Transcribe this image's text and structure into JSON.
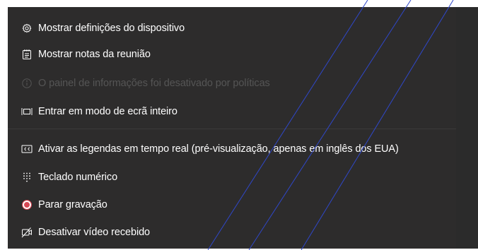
{
  "menu": {
    "items": [
      {
        "label": "Mostrar definições do dispositivo",
        "icon": "gear-icon",
        "enabled": true
      },
      {
        "label": "Mostrar notas da reunião",
        "icon": "notes-icon",
        "enabled": true
      },
      {
        "label": "O painel de informações foi desativado por políticas",
        "icon": "info-icon",
        "enabled": false
      },
      {
        "label": "Entrar em modo de ecrã inteiro",
        "icon": "fullscreen-icon",
        "enabled": true
      },
      {
        "label": "Ativar as legendas em tempo real (pré-visualização, apenas em inglês dos EUA)",
        "icon": "captions-icon",
        "enabled": true
      },
      {
        "label": "Teclado numérico",
        "icon": "dialpad-icon",
        "enabled": true
      },
      {
        "label": "Parar gravação",
        "icon": "record-icon",
        "enabled": true
      },
      {
        "label": "Desativar vídeo recebido",
        "icon": "video-off-icon",
        "enabled": true
      }
    ]
  },
  "colors": {
    "menu_background": "#2d2c2c",
    "text": "#ffffff",
    "disabled_text": "#555555",
    "record_red": "#d74654",
    "annotation_line": "#2f47c9"
  }
}
